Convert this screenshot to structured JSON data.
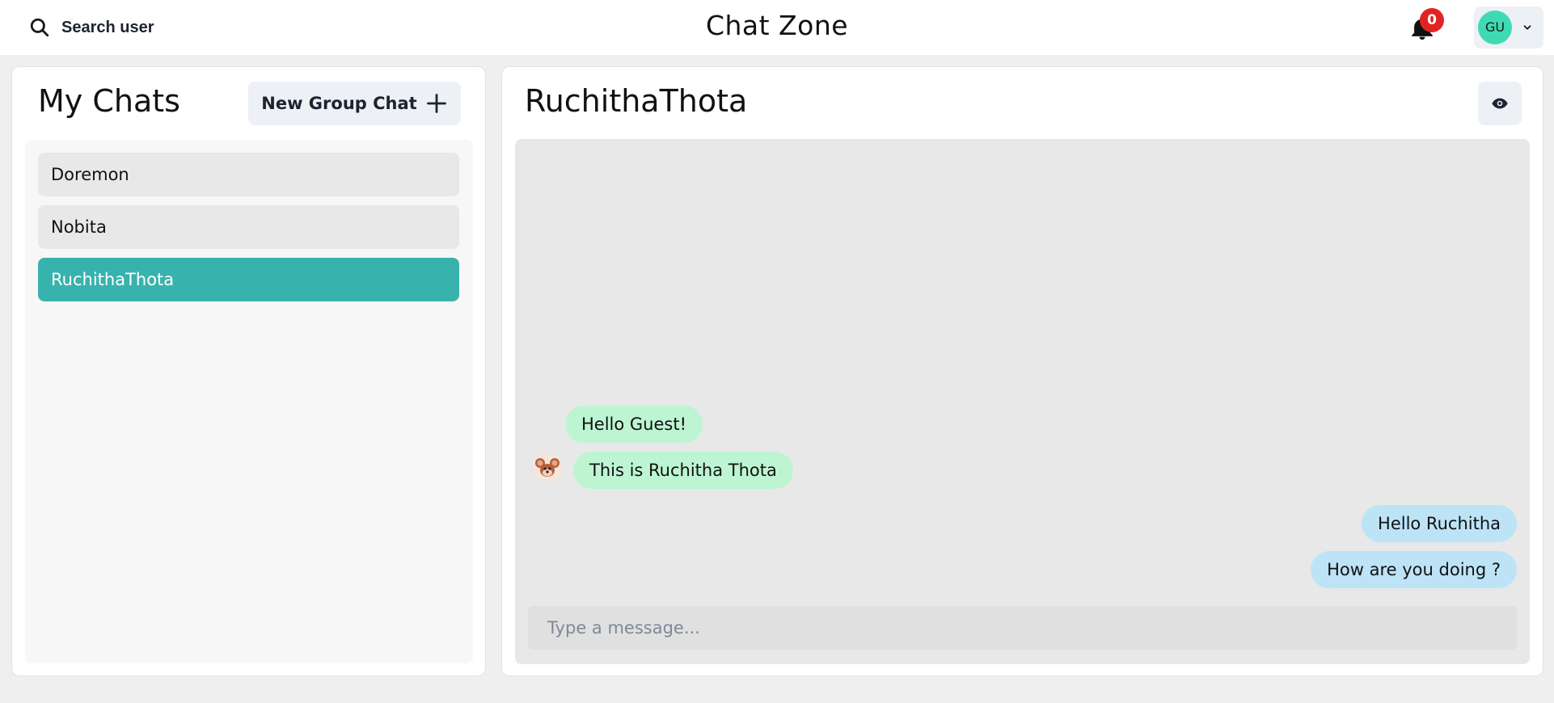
{
  "header": {
    "search_label": "Search user",
    "app_title": "Chat Zone",
    "notification_count": "0",
    "user_initials": "GU"
  },
  "sidebar": {
    "title": "My Chats",
    "new_group_label": "New Group Chat",
    "chats": [
      {
        "name": "Doremon",
        "active": false
      },
      {
        "name": "Nobita",
        "active": false
      },
      {
        "name": "RuchithaThota",
        "active": true
      }
    ]
  },
  "chat": {
    "title": "RuchithaThota",
    "messages": [
      {
        "text": "Hello Guest!",
        "direction": "received"
      },
      {
        "text": "This is Ruchitha Thota",
        "direction": "received"
      },
      {
        "text": "Hello Ruchitha",
        "direction": "sent"
      },
      {
        "text": "How are you doing ?",
        "direction": "sent"
      }
    ],
    "input_placeholder": "Type a message..."
  },
  "colors": {
    "active_chat": "#38b2ac",
    "received_bubble": "#bdf5d3",
    "sent_bubble": "#bde3f7",
    "badge": "#e02424",
    "avatar": "#3fdab4"
  },
  "icons": {
    "search": "search-icon",
    "bell": "bell-icon",
    "chevron": "chevron-down-icon",
    "plus": "plus-icon",
    "eye": "eye-icon"
  }
}
